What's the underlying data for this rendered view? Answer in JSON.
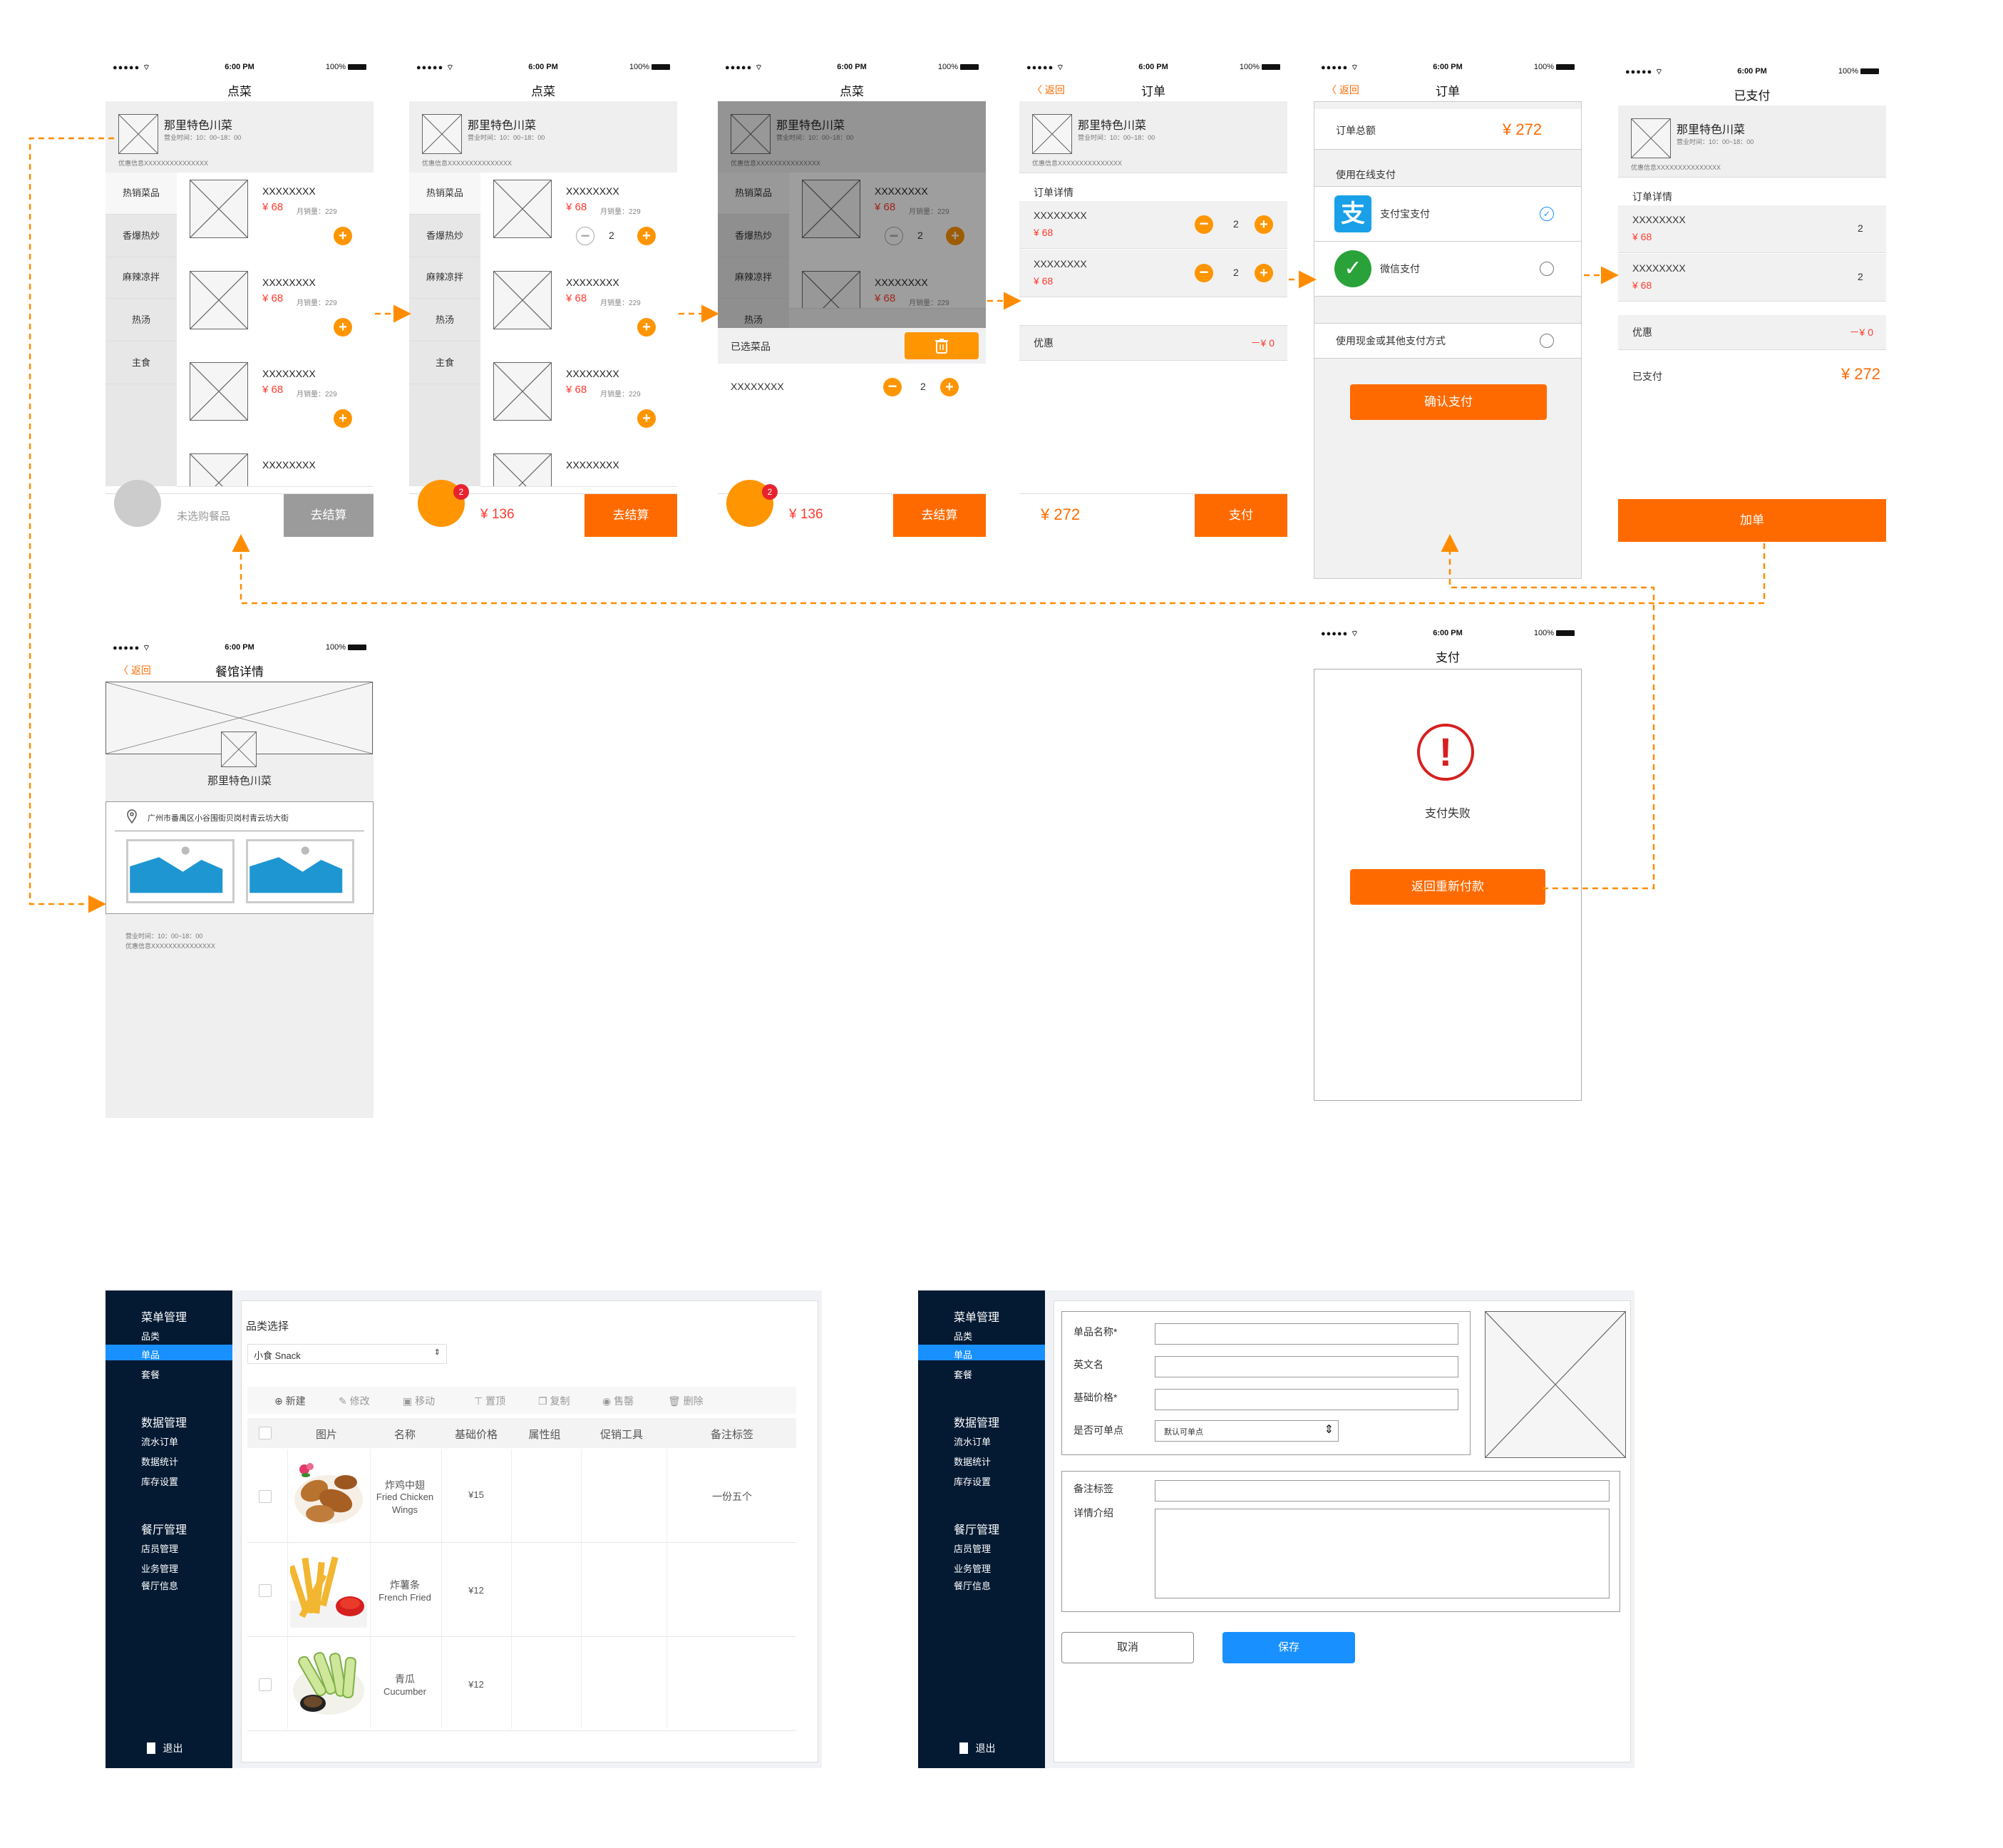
{
  "status": {
    "signal": "●●●●● ⌔",
    "time": "6:00 PM",
    "battery": "100%"
  },
  "nav": {
    "order_title": "点菜",
    "order2_title": "订单",
    "paid_title": "已支付",
    "detail_title": "餐馆详情",
    "pay_title": "支付",
    "back": "〈 返回"
  },
  "shop": {
    "name": "那里特色川菜",
    "hours": "营业时间：10：00~18：00",
    "promo": "优惠信息XXXXXXXXXXXXXXX",
    "address": "广州市番禺区小谷围街贝岗村青云坊大街"
  },
  "categories": [
    "热销菜品",
    "香爆热炒",
    "麻辣凉拌",
    "热汤",
    "主食"
  ],
  "dish": {
    "name": "XXXXXXXX",
    "price": "¥ 68",
    "sales": "月销量：229",
    "qty": "2",
    "plus": "+",
    "minus": "−"
  },
  "cart": {
    "empty_hint": "未选购餐品",
    "checkout": "去结算",
    "total": "¥ 136",
    "badge": "2",
    "selected_label": "已选菜品"
  },
  "order": {
    "detail_label": "订单详情",
    "discount_label": "优惠",
    "discount_value": "－¥ 0",
    "total": "¥ 272",
    "pay_button": "支付"
  },
  "payment": {
    "total_label": "订单总额",
    "total_value": "¥ 272",
    "online_label": "使用在线支付",
    "alipay": "支付宝支付",
    "wechat": "微信支付",
    "cash": "使用现金或其他支付方式",
    "confirm": "确认支付"
  },
  "paid": {
    "paid_label": "已支付",
    "paid_value": "¥ 272",
    "add_order": "加单"
  },
  "fail": {
    "message": "支付失败",
    "retry": "返回重新付款",
    "icon": "!"
  },
  "admin": {
    "menu_heading": "菜单管理",
    "menu_items": [
      "品类",
      "单品",
      "套餐"
    ],
    "data_heading": "数据管理",
    "data_items": [
      "流水订单",
      "数据统计",
      "库存设置"
    ],
    "rest_heading": "餐厅管理",
    "rest_items": [
      "店员管理",
      "业务管理",
      "餐厅信息"
    ],
    "logout": "退出",
    "category_label": "品类选择",
    "category_value": "小食 Snack",
    "toolbar": [
      "新建",
      "修改",
      "移动",
      "置顶",
      "复制",
      "售罄",
      "删除"
    ],
    "columns": [
      "图片",
      "名称",
      "基础价格",
      "属性组",
      "促销工具",
      "备注标签"
    ],
    "rows": [
      {
        "name_cn": "炸鸡中翅",
        "name_en": "Fried Chicken Wings",
        "price": "¥15",
        "tag": "一份五个"
      },
      {
        "name_cn": "炸薯条",
        "name_en": "French Fried",
        "price": "¥12",
        "tag": ""
      },
      {
        "name_cn": "青瓜",
        "name_en": "Cucumber",
        "price": "¥12",
        "tag": ""
      }
    ]
  },
  "form": {
    "name_label": "单品名称*",
    "en_label": "英文名",
    "price_label": "基础价格*",
    "orderable_label": "是否可单点",
    "orderable_value": "默认可单点",
    "tag_label": "备注标签",
    "intro_label": "详情介绍",
    "cancel": "取消",
    "save": "保存"
  },
  "colors": {
    "accent": "#ff6a00",
    "orange": "#ff9500",
    "price_red": "#ff3b30",
    "sidebar": "#041a33",
    "blue": "#1890ff",
    "flow_line": "#ff8c00"
  }
}
